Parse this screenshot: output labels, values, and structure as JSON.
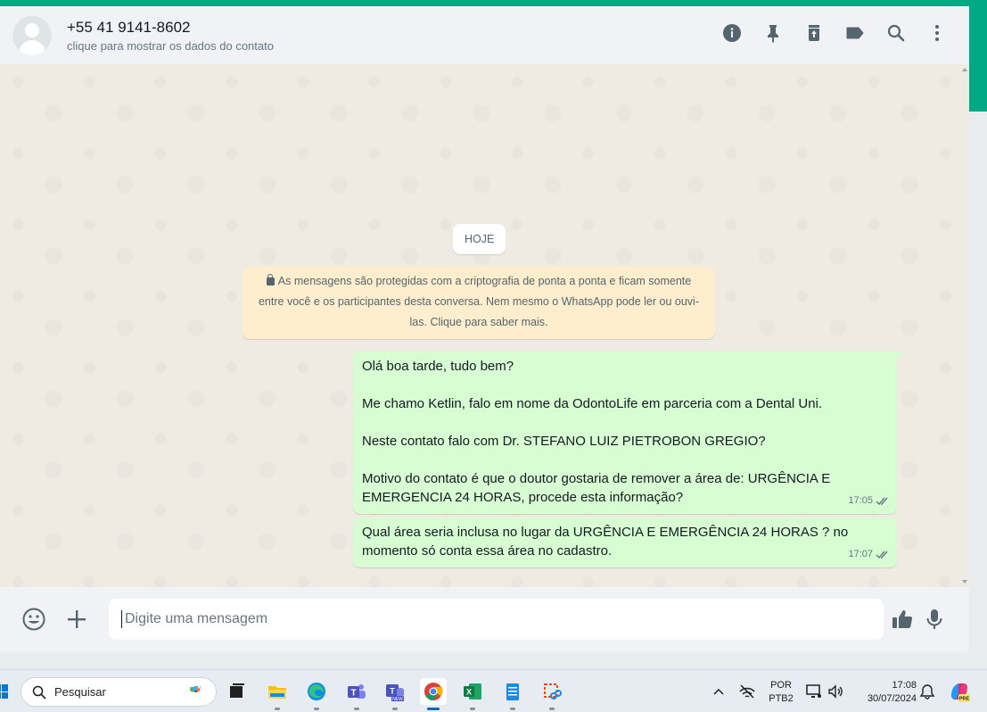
{
  "header": {
    "contact_name": "+55 41 9141-8602",
    "contact_subtitle": "clique para mostrar os dados do contato",
    "icons": [
      "info-icon",
      "pin-icon",
      "delete-icon",
      "label-icon",
      "search-icon",
      "menu-icon"
    ]
  },
  "chat": {
    "date_chip": "HOJE",
    "encryption_notice": "As mensagens são protegidas com a criptografia de ponta a ponta e ficam somente entre você e os participantes desta conversa. Nem mesmo o WhatsApp pode ler ou ouvi-las. Clique para saber mais.",
    "messages": [
      {
        "lines": [
          "Olá boa tarde, tudo bem?",
          "",
          "Me chamo Ketlin, falo em nome da OdontoLife em parceria com a Dental Uni.",
          "",
          "Neste contato falo com Dr. STEFANO LUIZ PIETROBON GREGIO?",
          "",
          "Motivo do contato é que o doutor gostaria de remover a área de: URGÊNCIA E EMERGENCIA 24 HORAS, procede esta informação?"
        ],
        "time": "17:05",
        "status": "delivered"
      },
      {
        "lines": [
          "Qual área seria inclusa no lugar da URGÊNCIA E EMERGÊNCIA 24 HORAS ? no momento só conta essa área no cadastro."
        ],
        "time": "17:07",
        "status": "delivered"
      }
    ]
  },
  "composer": {
    "placeholder": "Digite uma mensagem"
  },
  "taskbar": {
    "search_label": "Pesquisar",
    "language_line1": "POR",
    "language_line2": "PTB2",
    "time": "17:08",
    "date": "30/07/2024",
    "apps": [
      "file-explorer-icon",
      "edge-icon",
      "teams-icon",
      "teams-new-icon",
      "chrome-icon",
      "excel-icon",
      "notepad-icon",
      "snipping-tool-icon"
    ]
  },
  "colors": {
    "accent": "#00a884",
    "bubble_out": "#d9fdd3",
    "notice": "#ffeecd",
    "chat_bg": "#efeae2"
  }
}
